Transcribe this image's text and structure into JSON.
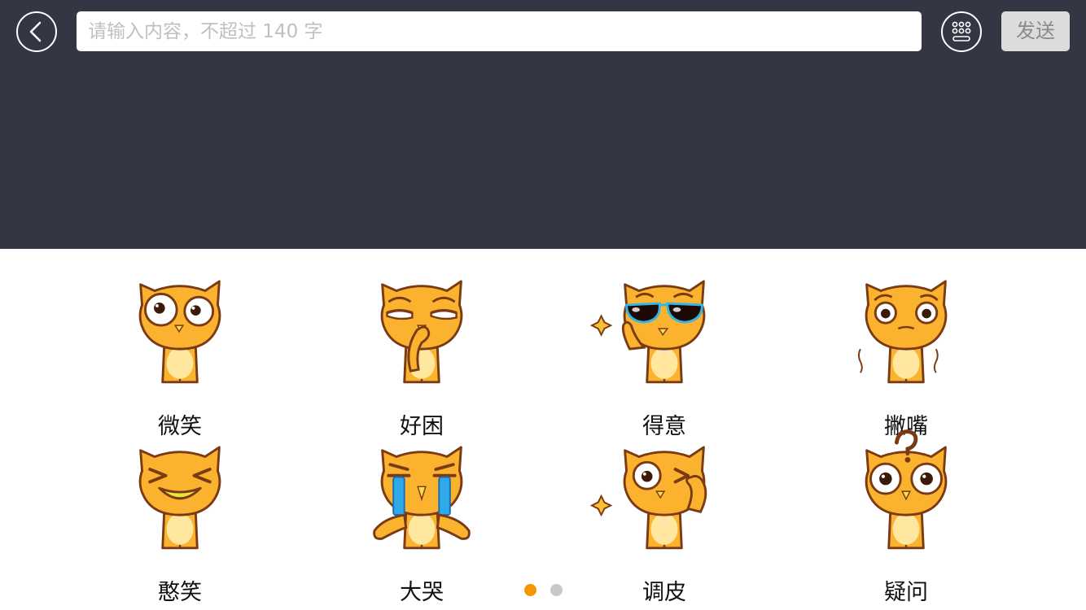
{
  "input": {
    "placeholder": "请输入内容，不超过 140 字",
    "value": ""
  },
  "toolbar": {
    "back_icon": "chevron-left-icon",
    "keyboard_icon": "keyboard-icon",
    "send_label": "发送"
  },
  "stickers": [
    {
      "label": "微笑",
      "expression": "smile"
    },
    {
      "label": "好困",
      "expression": "sleepy"
    },
    {
      "label": "得意",
      "expression": "cool-sunglasses"
    },
    {
      "label": "撇嘴",
      "expression": "pout"
    },
    {
      "label": "憨笑",
      "expression": "grin"
    },
    {
      "label": "大哭",
      "expression": "cry"
    },
    {
      "label": "调皮",
      "expression": "wink"
    },
    {
      "label": "疑问",
      "expression": "question"
    }
  ],
  "pagination": {
    "current_page": 1,
    "total_pages": 2
  },
  "colors": {
    "top_background": "#353643",
    "cat_body": "#FBB22F",
    "cat_outline": "#7A3B14",
    "cat_belly": "#FFE7A0",
    "dot_active": "#F39600",
    "dot_inactive": "#C8C8C8",
    "send_bg": "#DCDCDC"
  }
}
